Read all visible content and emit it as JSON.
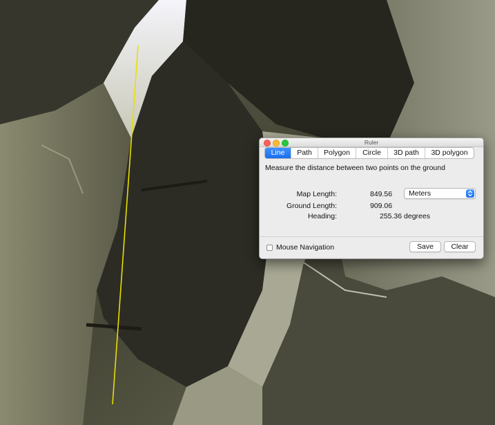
{
  "window": {
    "title": "Ruler"
  },
  "tabs": [
    {
      "label": "Line",
      "active": true
    },
    {
      "label": "Path",
      "active": false
    },
    {
      "label": "Polygon",
      "active": false
    },
    {
      "label": "Circle",
      "active": false
    },
    {
      "label": "3D path",
      "active": false
    },
    {
      "label": "3D polygon",
      "active": false
    }
  ],
  "description": "Measure the distance between two points on the ground",
  "measurements": {
    "map_length_label": "Map Length:",
    "map_length_value": "849.56",
    "ground_length_label": "Ground Length:",
    "ground_length_value": "909.06",
    "heading_label": "Heading:",
    "heading_value": "255.36 degrees"
  },
  "units": {
    "selected": "Meters"
  },
  "footer": {
    "mouse_navigation_label": "Mouse Navigation",
    "mouse_navigation_checked": false,
    "save_label": "Save",
    "clear_label": "Clear"
  },
  "colors": {
    "measure_line": "#e8e000",
    "accent": "#1a6ef0"
  }
}
